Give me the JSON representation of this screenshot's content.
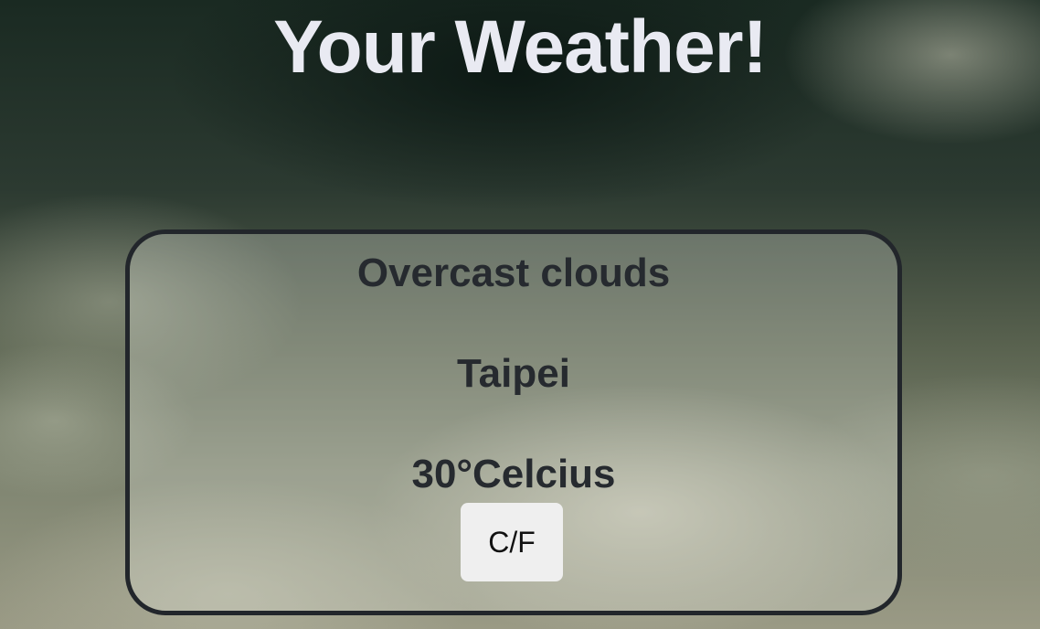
{
  "header": {
    "title": "Your Weather!"
  },
  "weather": {
    "description": "Overcast clouds",
    "city": "Taipei",
    "temperature": "30°Celcius",
    "unit_toggle_label": "C/F"
  }
}
